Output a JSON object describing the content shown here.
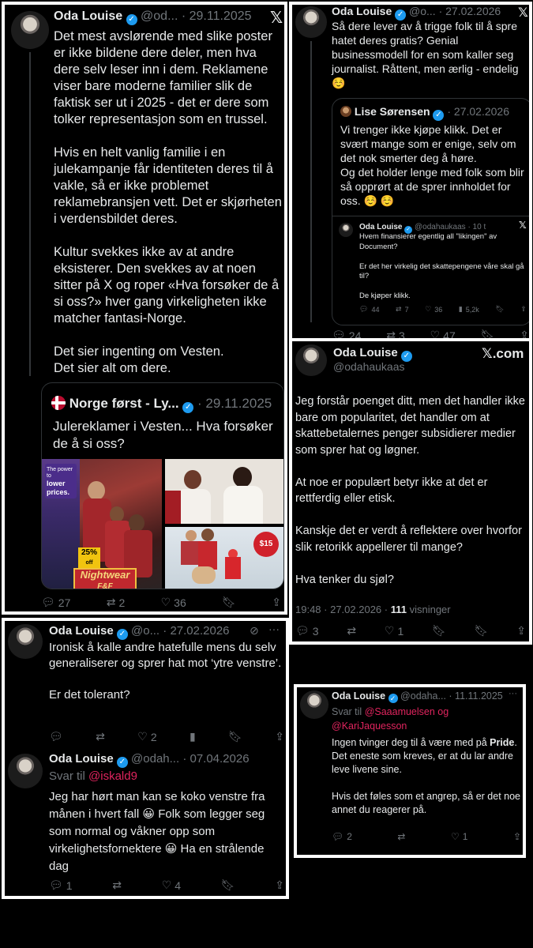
{
  "p1": {
    "name": "Oda Louise",
    "handle": "@od...",
    "date": "· 29.11.2025",
    "body": "Det mest avslørende med slike poster er ikke bildene dere deler, men hva dere selv leser inn i dem. Reklamene viser bare moderne familier slik de faktisk ser ut i 2025 - det er dere som tolker representasjon som en trussel.\n\nHvis en helt vanlig familie i en julekampanje får identiteten deres til å vakle, så er ikke problemet reklamebransjen vett. Det er skjørheten i verdensbildet deres.\n\nKultur svekkes ikke av at andre eksisterer. Den svekkes av at noen sitter på X og roper «Hva forsøker de å si oss?» hver gang virkeligheten ikke matcher fantasi-Norge.\n\nDet sier ingenting om Vesten.\nDet sier alt om dere.",
    "quote": {
      "name": "Norge først - Ly...",
      "date": "· 29.11.2025",
      "body": "Julereklamer i Vesten... Hva forsøker de å si oss?",
      "ad": {
        "power": "The power to",
        "lower": "lower prices.",
        "badge": "25%",
        "off": "off",
        "nightwear": "Nightwear",
        "brand": "F&F",
        "price": "$15"
      }
    },
    "actions": {
      "replies": "27",
      "reposts": "2",
      "likes": "36"
    }
  },
  "p2": {
    "name": "Oda Louise",
    "handle": "@o...",
    "date": "· 27.02.2026",
    "body": "Så dere lever av å trigge folk til å spre hatet deres gratis? Genial businessmodell for en som kaller seg journalist. Råttent, men ærlig - endelig ☺️",
    "quote": {
      "name": "Lise Sørensen",
      "date": "· 27.02.2026",
      "body": "Vi trenger ikke kjøpe klikk. Det er svært mange som er enige, selv om det nok smerter deg å høre.\nOg det holder lenge med folk som blir så opprørt at de sprer innholdet for oss. ☺️ ☺️",
      "inner": {
        "name": "Oda Louise",
        "handle": "@odahaukaas · 10 t",
        "body": "Hvem finansierer egentlig all \"likingen\" av Document?\n\nEr det her virkelig det skattepengene våre skal gå til?\n\nDe kjøper klikk.",
        "actions": {
          "replies": "44",
          "reposts": "7",
          "likes": "36",
          "views": "5,2k"
        }
      }
    },
    "actions": {
      "replies": "24",
      "reposts": "3",
      "likes": "47"
    }
  },
  "p3": {
    "name": "Oda Louise",
    "handle": "@odahaukaas",
    "xcom": "𝕏.com",
    "body": "Jeg forstår poenget ditt, men det handler ikke bare om popularitet, det handler om at skattebetalernes penger subsidierer medier som sprer hat og løgner.\n\nAt noe er populært betyr ikke at det er rettferdig eller etisk.\n\nKanskje det er verdt å reflektere over hvorfor slik retorikk appellerer til mange?\n\nHva tenker du sjøl?",
    "meta_time": "19:48 · 27.02.2026 · ",
    "meta_views": "111",
    "meta_views_label": " visninger",
    "actions": {
      "replies": "3",
      "likes": "1"
    }
  },
  "p4": {
    "t1": {
      "name": "Oda Louise",
      "handle": "@o...",
      "date": "· 27.02.2026",
      "body": "Ironisk å kalle andre hatefulle mens du selv generaliserer og sprer hat mot ‘ytre venstre’.\n\nEr det tolerant?",
      "actions": {
        "likes": "2"
      }
    },
    "t2": {
      "name": "Oda Louise",
      "handle": "@odah...",
      "date": "· 07.04.2026",
      "reply_prefix": "Svar til ",
      "reply_to": "@iskald9",
      "body": "Jeg har hørt man kan se koko venstre fra månen i hvert fall 😀 Folk som legger seg som normal og våkner opp som virkelighetsfornektere 😀 Ha en strålende dag",
      "actions": {
        "replies": "1",
        "likes": "4"
      }
    }
  },
  "p5": {
    "name": "Oda Louise",
    "handle": "@odaha...",
    "date": "· 11.11.2025",
    "reply_prefix": "Svar til ",
    "reply_to1": "@Saaamuelsen",
    "reply_and": " og",
    "reply_to2": "@KariJaquesson",
    "body_a": "Ingen tvinger deg til å være med på ",
    "body_bold": "Pride",
    "body_b": ".\nDet eneste som kreves, er at du lar andre leve livene sine.\n\nHvis det føles som et angrep, så er det noe annet du reagerer på.",
    "actions": {
      "replies": "2",
      "likes": "1"
    }
  },
  "colors": {
    "accent": "#1d9bf0",
    "link": "#e0245e",
    "muted": "#71767b"
  }
}
